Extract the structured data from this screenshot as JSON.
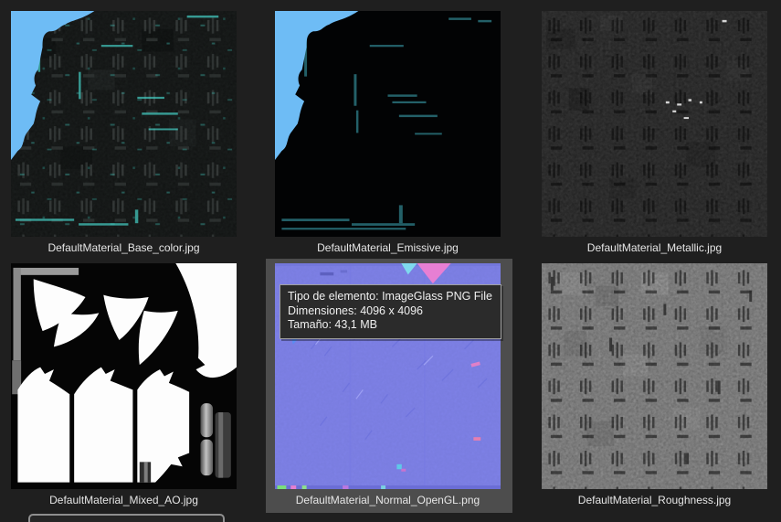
{
  "window": {
    "background_color": "#1f1f1f",
    "hover_background_color": "#4d4d4d",
    "label_text_color": "#e6e6e6"
  },
  "palette": {
    "atlas_backdrop_blue": "#6ebcf5",
    "normal_map_purple": "#8184ec",
    "emissive_teal": "#49c8c8",
    "roughness_gray": "#8f8f8f",
    "tooltip_background": "#2b2b2b",
    "tooltip_border": "#a0a0a0"
  },
  "files": [
    {
      "name": "DefaultMaterial_Base_color.jpg",
      "kind": "base-color-texture"
    },
    {
      "name": "DefaultMaterial_Emissive.jpg",
      "kind": "emissive-texture"
    },
    {
      "name": "DefaultMaterial_Metallic.jpg",
      "kind": "metallic-texture"
    },
    {
      "name": "DefaultMaterial_Mixed_AO.jpg",
      "kind": "ambient-occlusion-texture"
    },
    {
      "name": "DefaultMaterial_Normal_OpenGL.png",
      "kind": "normal-map-texture",
      "state": "hovered"
    },
    {
      "name": "DefaultMaterial_Roughness.jpg",
      "kind": "roughness-texture"
    }
  ],
  "tooltip": {
    "line1": "Tipo de elemento: ImageGlass PNG File",
    "line2": "Dimensiones: 4096 x 4096",
    "line3": "Tamaño: 43,1 MB"
  }
}
